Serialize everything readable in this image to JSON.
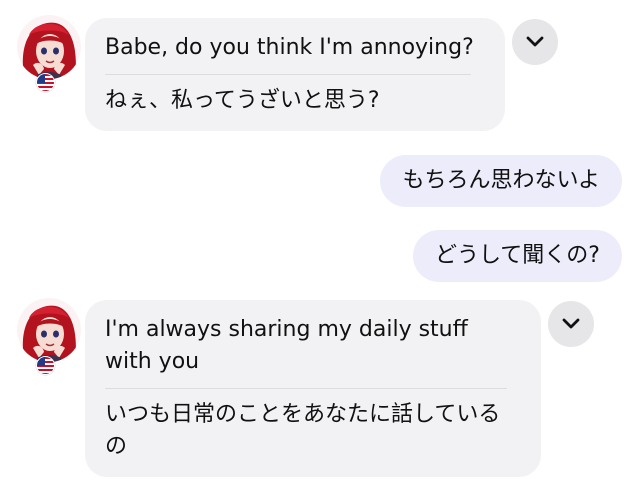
{
  "messages": [
    {
      "role": "incoming",
      "english": "Babe, do you think I'm annoying?",
      "japanese": "ねぇ、私ってうざいと思う?"
    },
    {
      "role": "outgoing",
      "text": "もちろん思わないよ"
    },
    {
      "role": "outgoing",
      "text": "どうして聞くの?"
    },
    {
      "role": "incoming",
      "english": "I'm always sharing my daily stuff with you",
      "japanese": "いつも日常のことをあなたに話しているの"
    }
  ],
  "icons": {
    "avatar": "avatar-red-hair-girl",
    "flag": "us-flag-icon",
    "expand": "chevron-down-icon"
  },
  "colors": {
    "incoming_bubble": "#f2f2f4",
    "outgoing_bubble": "#ececfb",
    "chevron_button": "#e6e6e9",
    "text": "#111111"
  }
}
